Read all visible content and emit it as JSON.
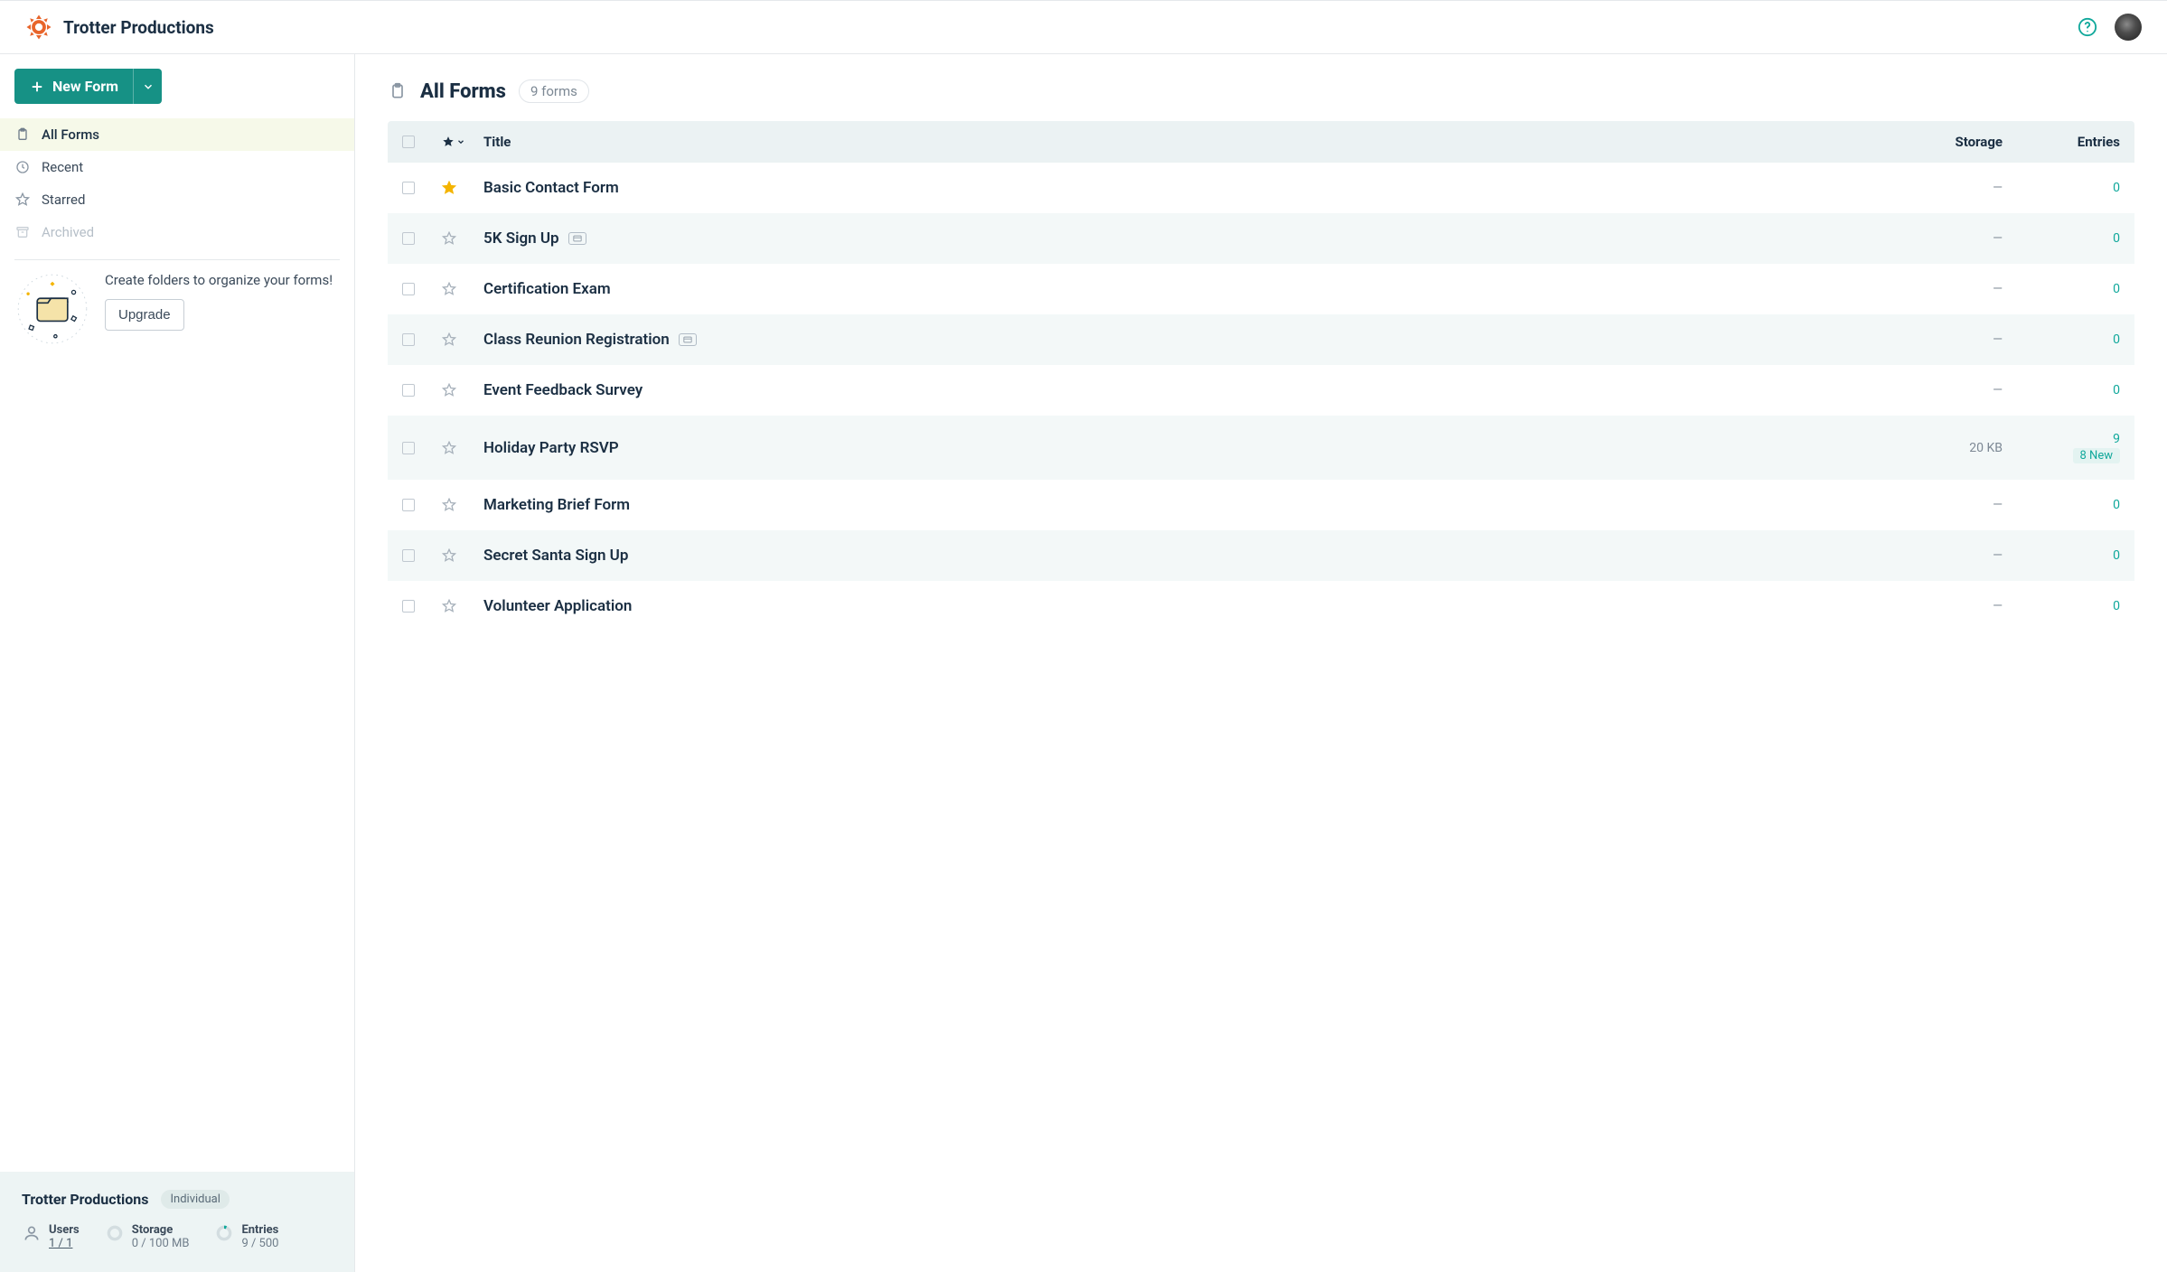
{
  "brand": {
    "name": "Trotter Productions"
  },
  "sidebar": {
    "new_form_label": "New Form",
    "nav": [
      {
        "label": "All Forms",
        "icon": "clipboard"
      },
      {
        "label": "Recent",
        "icon": "clock"
      },
      {
        "label": "Starred",
        "icon": "star"
      },
      {
        "label": "Archived",
        "icon": "archive"
      }
    ],
    "promo": {
      "text": "Create folders to organize your forms!",
      "cta": "Upgrade"
    }
  },
  "footer": {
    "org": "Trotter Productions",
    "plan": "Individual",
    "stats": {
      "users": {
        "label": "Users",
        "value": "1 / 1"
      },
      "storage": {
        "label": "Storage",
        "value": "0 / 100 MB"
      },
      "entries": {
        "label": "Entries",
        "value": "9 / 500"
      }
    }
  },
  "page": {
    "title": "All Forms",
    "count": "9 forms"
  },
  "columns": {
    "title": "Title",
    "storage": "Storage",
    "entries": "Entries"
  },
  "rows": [
    {
      "title": "Basic Contact Form",
      "starred": true,
      "badge": false,
      "storage": "—",
      "entries": "0",
      "new": ""
    },
    {
      "title": "5K Sign Up",
      "starred": false,
      "badge": true,
      "storage": "—",
      "entries": "0",
      "new": ""
    },
    {
      "title": "Certification Exam",
      "starred": false,
      "badge": false,
      "storage": "—",
      "entries": "0",
      "new": ""
    },
    {
      "title": "Class Reunion Registration",
      "starred": false,
      "badge": true,
      "storage": "—",
      "entries": "0",
      "new": ""
    },
    {
      "title": "Event Feedback Survey",
      "starred": false,
      "badge": false,
      "storage": "—",
      "entries": "0",
      "new": ""
    },
    {
      "title": "Holiday Party RSVP",
      "starred": false,
      "badge": false,
      "storage": "20 KB",
      "entries": "9",
      "new": "8 New"
    },
    {
      "title": "Marketing Brief Form",
      "starred": false,
      "badge": false,
      "storage": "—",
      "entries": "0",
      "new": ""
    },
    {
      "title": "Secret Santa Sign Up",
      "starred": false,
      "badge": false,
      "storage": "—",
      "entries": "0",
      "new": ""
    },
    {
      "title": "Volunteer Application",
      "starred": false,
      "badge": false,
      "storage": "—",
      "entries": "0",
      "new": ""
    }
  ]
}
